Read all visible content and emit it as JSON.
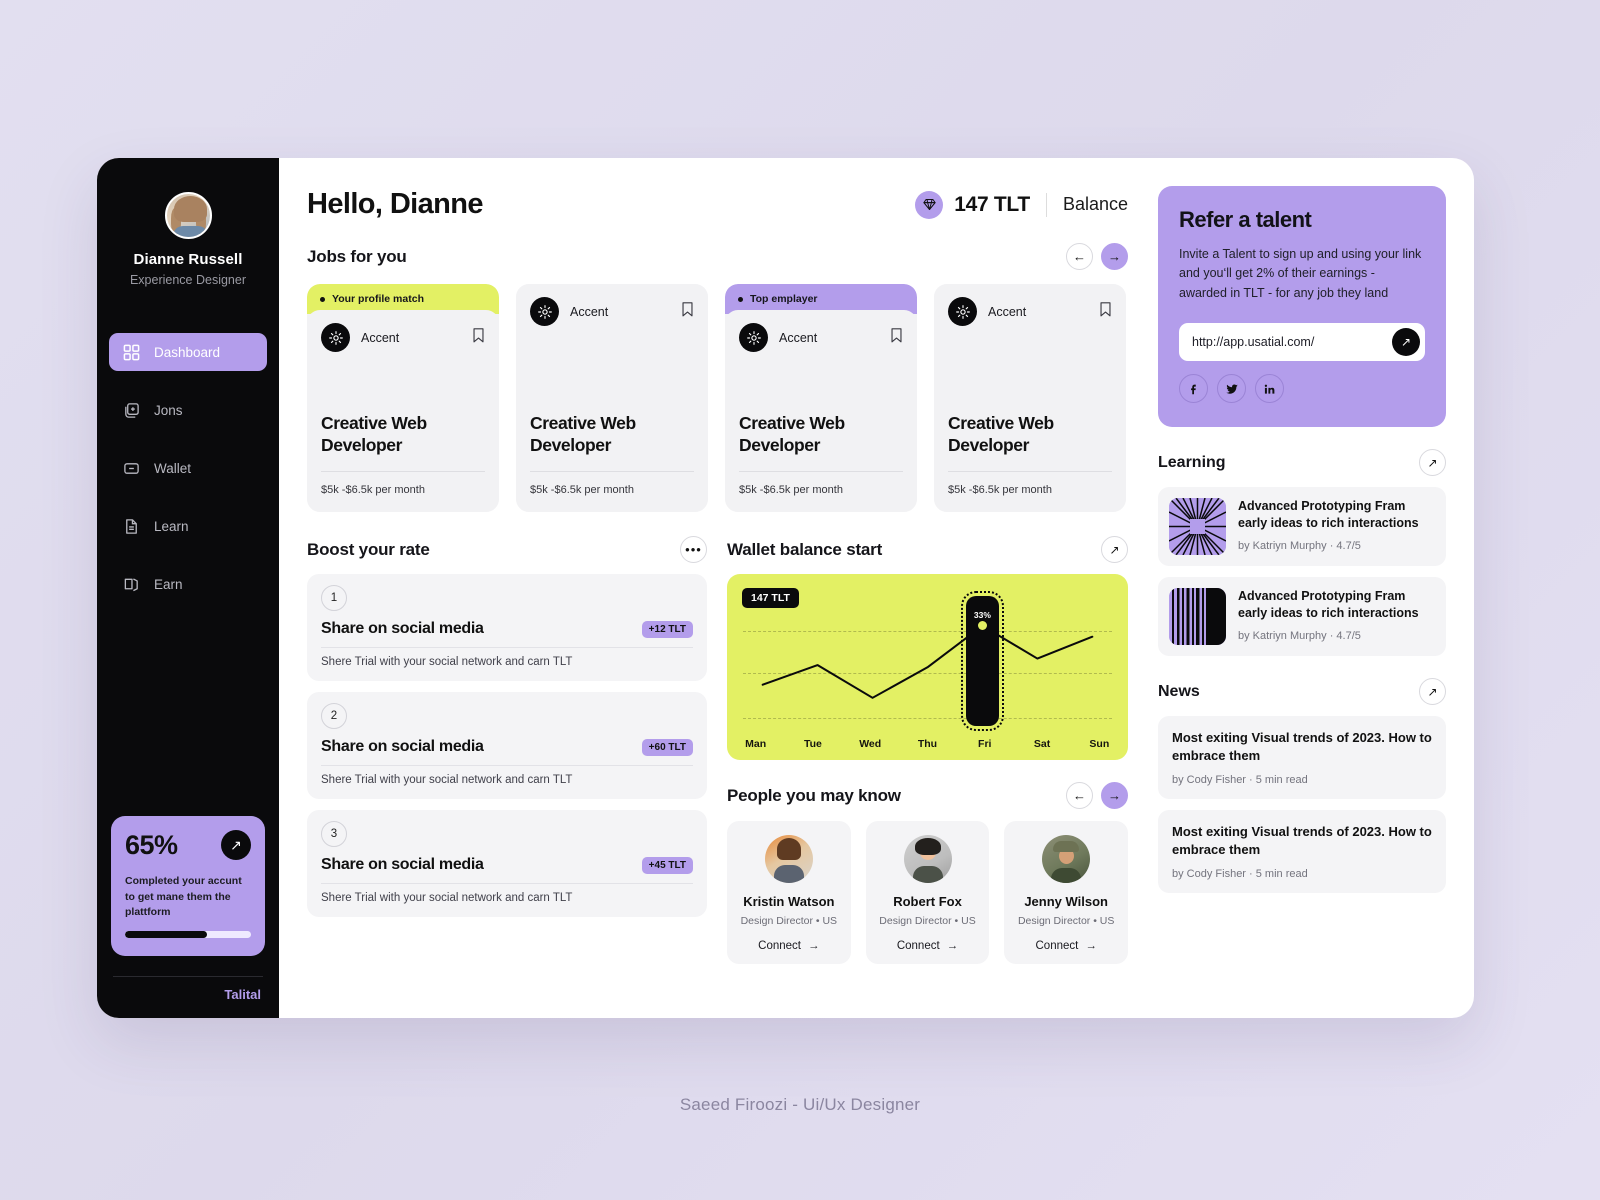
{
  "sidebar": {
    "user_name": "Dianne Russell",
    "user_role": "Experience Designer",
    "items": [
      {
        "label": "Dashboard",
        "icon": "grid-icon"
      },
      {
        "label": "Jons",
        "icon": "add-square-icon"
      },
      {
        "label": "Wallet",
        "icon": "minus-square-icon"
      },
      {
        "label": "Learn",
        "icon": "document-icon"
      },
      {
        "label": "Earn",
        "icon": "copy-icon"
      }
    ],
    "promo": {
      "percent": "65%",
      "text": "Completed your accunt to get mane them the plattform",
      "progress": 65
    },
    "brand": "Talital"
  },
  "header": {
    "greeting": "Hello, Dianne",
    "balance_amount": "147 TLT",
    "balance_label": "Balance",
    "gem_color": "#b39deb"
  },
  "jobs_section": {
    "title": "Jobs for you",
    "prev_label": "←",
    "next_label": "→",
    "cards": [
      {
        "ribbon": "Your profile match",
        "ribbon_color": "#e3f064",
        "company": "Accent",
        "title": "Creative Web Developer",
        "pay": "$5k -$6.5k per month"
      },
      {
        "ribbon": "",
        "ribbon_color": "",
        "company": "Accent",
        "title": "Creative Web Developer",
        "pay": "$5k -$6.5k per month"
      },
      {
        "ribbon": "Top emplayer",
        "ribbon_color": "#b39deb",
        "company": "Accent",
        "title": "Creative Web Developer",
        "pay": "$5k -$6.5k per month"
      },
      {
        "ribbon": "",
        "ribbon_color": "",
        "company": "Accent",
        "title": "Creative Web Developer",
        "pay": "$5k -$6.5k per month"
      }
    ]
  },
  "boost": {
    "title": "Boost your rate",
    "more_label": "•••",
    "items": [
      {
        "num": "1",
        "title": "Share on social media",
        "badge": "+12 TLT",
        "sub": "Shere Trial with your social network and carn TLT"
      },
      {
        "num": "2",
        "title": "Share on social media",
        "badge": "+60 TLT",
        "sub": "Shere Trial with your social network and carn TLT"
      },
      {
        "num": "3",
        "title": "Share on social media",
        "badge": "+45 TLT",
        "sub": "Shere Trial with your social network and carn TLT"
      }
    ]
  },
  "wallet": {
    "title": "Wallet balance start",
    "expand_label": "↗",
    "chip": "147 TLT"
  },
  "chart_data": {
    "type": "line",
    "title": "Wallet balance start",
    "categories": [
      "Man",
      "Tue",
      "Wed",
      "Thu",
      "Fri",
      "Sat",
      "Sun"
    ],
    "values": [
      18,
      27,
      12,
      26,
      45,
      30,
      40
    ],
    "highlight_index": 4,
    "highlight_label": "33%",
    "badge": "147 TLT",
    "xlabel": "",
    "ylabel": "",
    "ylim": [
      0,
      55
    ],
    "grid": true,
    "grid_lines": 3,
    "line_color": "#0a0a0c",
    "background": "#e3f064",
    "legend": "none"
  },
  "people": {
    "title": "People you may know",
    "prev_label": "←",
    "next_label": "→",
    "connect_label": "Connect",
    "items": [
      {
        "name": "Kristin Watson",
        "role": "Design Director  •   US"
      },
      {
        "name": "Robert Fox",
        "role": "Design Director  •   US"
      },
      {
        "name": "Jenny Wilson",
        "role": "Design Director  •   US"
      }
    ]
  },
  "refer": {
    "title": "Refer a talent",
    "body": "Invite a Talent to sign up and using your link and you‘ll get 2% of their earnings - awarded in TLT - for any job they land",
    "link": "http://app.usatial.com/",
    "go_label": "↗",
    "socials": [
      "facebook-icon",
      "twitter-icon",
      "linkedin-icon"
    ],
    "bg_color": "#b39deb"
  },
  "learning": {
    "title": "Learning",
    "expand_label": "↗",
    "items": [
      {
        "title": "Advanced Prototyping Fram early ideas to rich interactions",
        "meta": "by Katriyn Murphy    ·   4.7/5",
        "thumb": "radial-burst"
      },
      {
        "title": "Advanced Prototyping Fram early ideas to rich interactions",
        "meta": "by Katriyn Murphy    ·   4.7/5",
        "thumb": "vertical-bars"
      }
    ]
  },
  "news": {
    "title": "News",
    "expand_label": "↗",
    "items": [
      {
        "title": "Most exiting Visual trends of 2023. How to embrace them",
        "meta": "by Cody Fisher   ·   5 min read"
      },
      {
        "title": "Most exiting Visual trends of 2023. How to embrace them",
        "meta": "by Cody Fisher   ·   5 min read"
      }
    ]
  },
  "footer": {
    "credit": "Saeed Firoozi - Ui/Ux Designer"
  }
}
